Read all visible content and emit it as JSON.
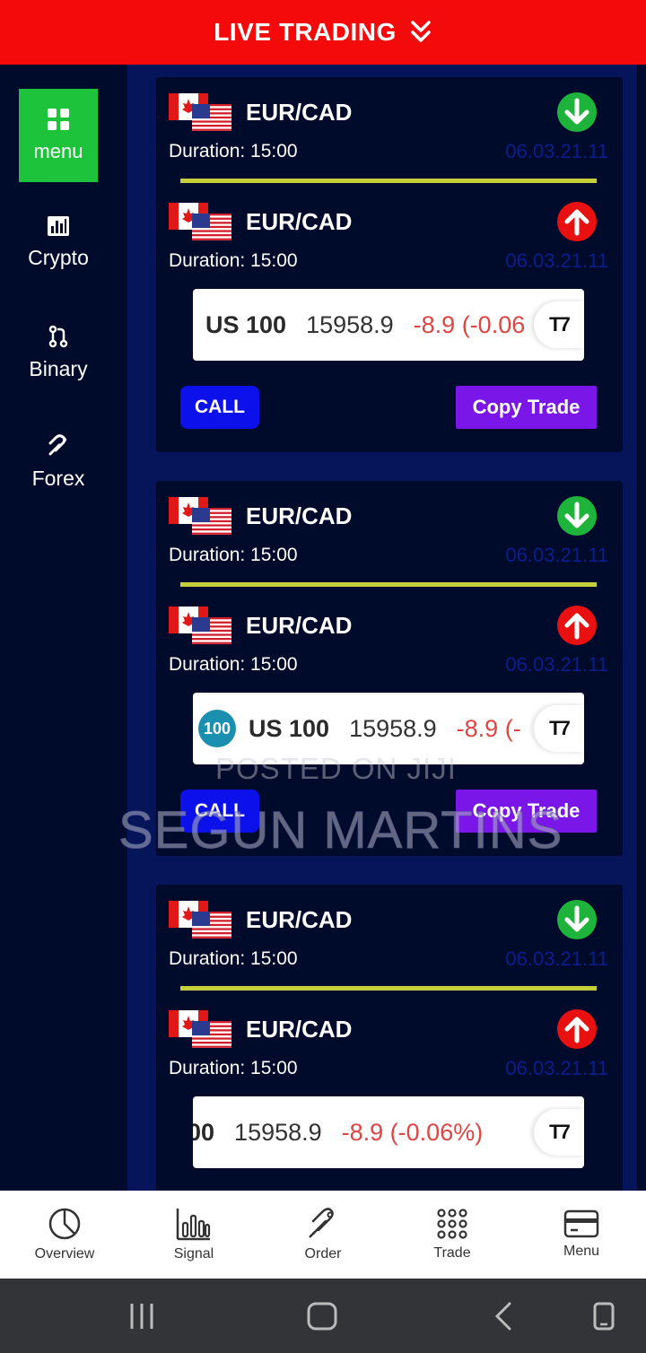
{
  "header": {
    "title": "LIVE TRADING"
  },
  "sidebar": {
    "items": [
      {
        "label": "menu"
      },
      {
        "label": "Crypto"
      },
      {
        "label": "Binary"
      },
      {
        "label": "Forex"
      }
    ]
  },
  "cards": [
    {
      "signals": [
        {
          "pair": "EUR/CAD",
          "duration": "Duration: 15:00",
          "date": "06.03.21.11",
          "direction": "down"
        },
        {
          "pair": "EUR/CAD",
          "duration": "Duration: 15:00",
          "date": "06.03.21.11",
          "direction": "up"
        }
      ],
      "ticker": {
        "symbol": "US 100",
        "price": "15958.9",
        "change": "-8.9 (-0.06"
      },
      "call_label": "CALL",
      "copy_label": "Copy Trade"
    },
    {
      "signals": [
        {
          "pair": "EUR/CAD",
          "duration": "Duration: 15:00",
          "date": "06.03.21.11",
          "direction": "down"
        },
        {
          "pair": "EUR/CAD",
          "duration": "Duration: 15:00",
          "date": "06.03.21.11",
          "direction": "up"
        }
      ],
      "ticker": {
        "badge": "100",
        "symbol": "US 100",
        "price": "15958.9",
        "change": "-8.9 (-"
      },
      "call_label": "CALL",
      "copy_label": "Copy Trade"
    },
    {
      "signals": [
        {
          "pair": "EUR/CAD",
          "duration": "Duration: 15:00",
          "date": "06.03.21.11",
          "direction": "down"
        },
        {
          "pair": "EUR/CAD",
          "duration": "Duration: 15:00",
          "date": "06.03.21.11",
          "direction": "up"
        }
      ],
      "ticker": {
        "symbol": "00",
        "price": "15958.9",
        "change": "-8.9 (-0.06%)"
      }
    }
  ],
  "watermark": {
    "line1": "POSTED ON JIJI",
    "line2": "SEGUN MARTINS"
  },
  "bottom_nav": [
    {
      "label": "Overview",
      "icon": "pie-chart-icon"
    },
    {
      "label": "Signal",
      "icon": "bar-chart-icon"
    },
    {
      "label": "Order",
      "icon": "rocket-icon"
    },
    {
      "label": "Trade",
      "icon": "grid-dots-icon"
    },
    {
      "label": "Menu",
      "icon": "card-icon"
    }
  ],
  "colors": {
    "header": "#f40a0a",
    "menu_active": "#1ec33c",
    "call_button": "#0c10ea",
    "copy_button": "#7a16e8",
    "up_arrow": "#e81010",
    "down_arrow": "#1eb43c"
  }
}
